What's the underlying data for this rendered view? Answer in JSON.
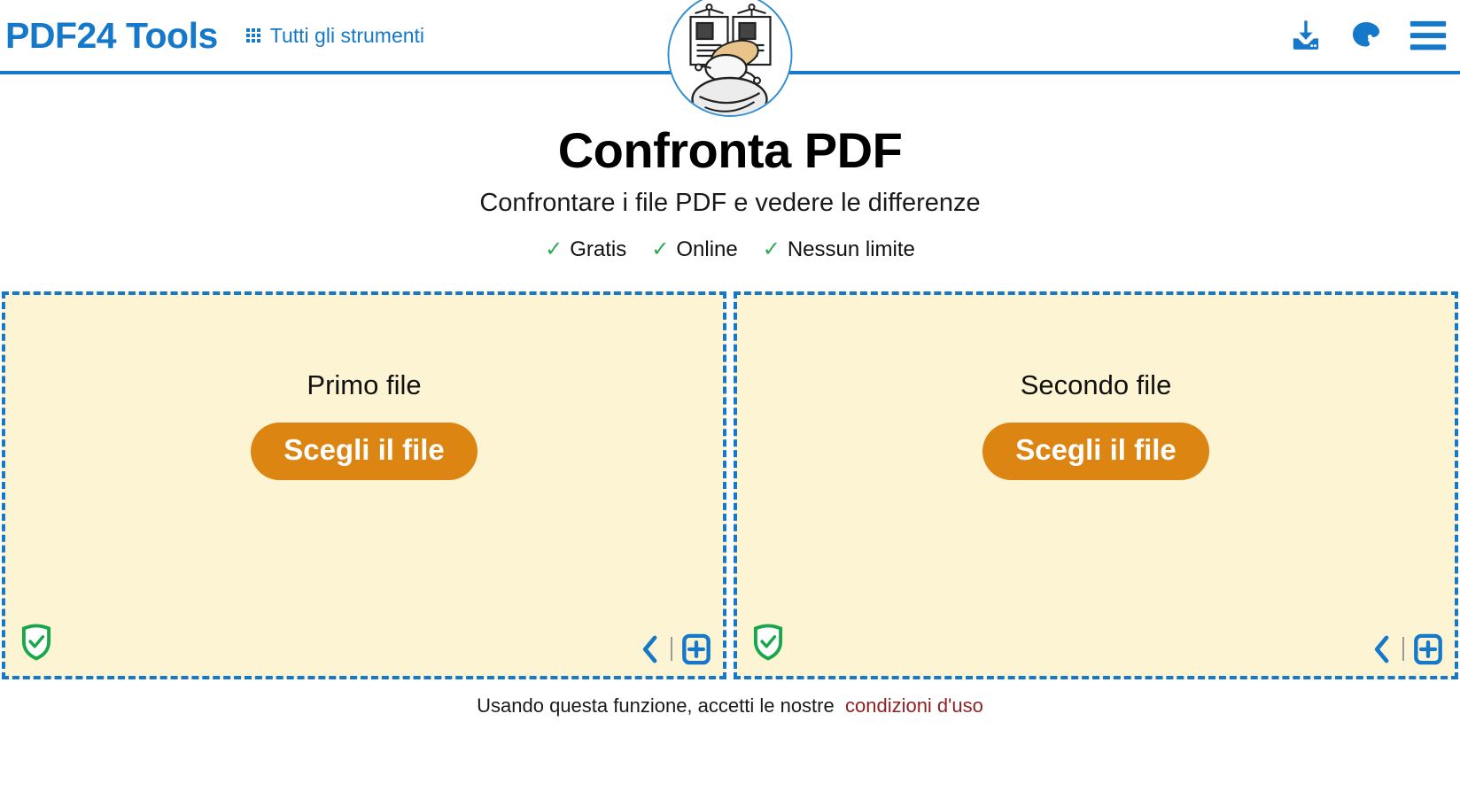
{
  "header": {
    "brand": "PDF24 Tools",
    "all_tools_label": "Tutti gli strumenti",
    "grid_icon": "grid-icon",
    "icons": [
      {
        "name": "download-icon",
        "title": "Download"
      },
      {
        "name": "palette-icon",
        "title": "Tema"
      },
      {
        "name": "hamburger-menu-icon",
        "title": "Menu"
      }
    ],
    "accent_color": "#1578c8",
    "logo_icon": "compare-pdf-logo"
  },
  "hero": {
    "title": "Confronta PDF",
    "subtitle": "Confrontare i file PDF e vedere le differenze",
    "check_glyph": "✓",
    "check_color": "#2eaa4e",
    "features": [
      {
        "label": "Gratis"
      },
      {
        "label": "Online"
      },
      {
        "label": "Nessun limite"
      }
    ]
  },
  "zones": [
    {
      "title": "Primo file",
      "button_label": "Scegli il file",
      "shield_icon": "shield-check-icon",
      "back_icon": "chevron-left-icon",
      "add_icon": "add-document-icon"
    },
    {
      "title": "Secondo file",
      "button_label": "Scegli il file",
      "shield_icon": "shield-check-icon",
      "back_icon": "chevron-left-icon",
      "add_icon": "add-document-icon"
    }
  ],
  "footer": {
    "text": "Usando questa funzione, accetti le nostre",
    "link_label": "condizioni d'uso",
    "link_color": "#8f2121"
  },
  "theme": {
    "zone_background": "#fdf4d3",
    "zone_border": "#1578c8",
    "button_background": "#dd8512"
  }
}
